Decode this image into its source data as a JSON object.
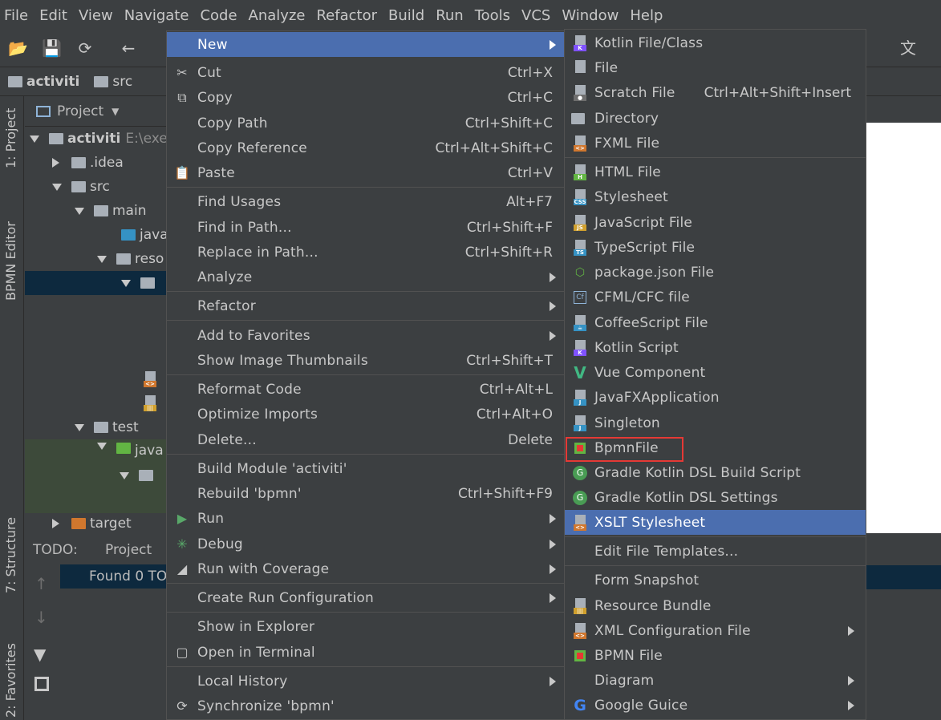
{
  "menubar": [
    "File",
    "Edit",
    "View",
    "Navigate",
    "Code",
    "Analyze",
    "Refactor",
    "Build",
    "Run",
    "Tools",
    "VCS",
    "Window",
    "Help"
  ],
  "breadcrumb": [
    "activiti",
    "src"
  ],
  "side_tabs": {
    "project": "1: Project",
    "bpmn_editor": "BPMN Editor",
    "structure": "7: Structure",
    "favorites": "2: Favorites"
  },
  "project_panel": {
    "title": "Project"
  },
  "tree": {
    "root": "activiti",
    "root_path": "E:\\exe",
    "idea": ".idea",
    "src": "src",
    "main": "main",
    "java": "java",
    "resources": "reso",
    "test": "test",
    "test_java": "java",
    "target": "target"
  },
  "todo": {
    "label": "TODO:",
    "tab": "Project",
    "status": "Found 0 TO"
  },
  "context_menu": {
    "new": "New",
    "cut": "Cut",
    "cut_sc": "Ctrl+X",
    "copy": "Copy",
    "copy_sc": "Ctrl+C",
    "copy_path": "Copy Path",
    "copy_path_sc": "Ctrl+Shift+C",
    "copy_ref": "Copy Reference",
    "copy_ref_sc": "Ctrl+Alt+Shift+C",
    "paste": "Paste",
    "paste_sc": "Ctrl+V",
    "find_usages": "Find Usages",
    "find_usages_sc": "Alt+F7",
    "find_in_path": "Find in Path...",
    "find_in_path_sc": "Ctrl+Shift+F",
    "replace_in_path": "Replace in Path...",
    "replace_in_path_sc": "Ctrl+Shift+R",
    "analyze": "Analyze",
    "refactor": "Refactor",
    "add_favorites": "Add to Favorites",
    "show_thumbs": "Show Image Thumbnails",
    "show_thumbs_sc": "Ctrl+Shift+T",
    "reformat": "Reformat Code",
    "reformat_sc": "Ctrl+Alt+L",
    "optimize": "Optimize Imports",
    "optimize_sc": "Ctrl+Alt+O",
    "delete": "Delete...",
    "delete_sc": "Delete",
    "build_module": "Build Module 'activiti'",
    "rebuild": "Rebuild 'bpmn'",
    "rebuild_sc": "Ctrl+Shift+F9",
    "run": "Run",
    "debug": "Debug",
    "run_coverage": "Run with Coverage",
    "create_run": "Create Run Configuration",
    "show_explorer": "Show in Explorer",
    "open_terminal": "Open in Terminal",
    "local_history": "Local History",
    "synchronize": "Synchronize 'bpmn'"
  },
  "new_submenu": {
    "kotlin_file": "Kotlin File/Class",
    "file": "File",
    "scratch": "Scratch File",
    "scratch_sc": "Ctrl+Alt+Shift+Insert",
    "directory": "Directory",
    "fxml": "FXML File",
    "html": "HTML File",
    "stylesheet": "Stylesheet",
    "js": "JavaScript File",
    "ts": "TypeScript File",
    "package_json": "package.json File",
    "cfml": "CFML/CFC file",
    "coffee": "CoffeeScript File",
    "kotlin_script": "Kotlin Script",
    "vue": "Vue Component",
    "javafx": "JavaFXApplication",
    "singleton": "Singleton",
    "bpmnfile": "BpmnFile",
    "gradle_build": "Gradle Kotlin DSL Build Script",
    "gradle_settings": "Gradle Kotlin DSL Settings",
    "xslt": "XSLT Stylesheet",
    "edit_templates": "Edit File Templates...",
    "form_snapshot": "Form Snapshot",
    "resource_bundle": "Resource Bundle",
    "xml_config": "XML Configuration File",
    "bpmn_file": "BPMN File",
    "diagram": "Diagram",
    "google_guice": "Google Guice"
  },
  "colors": {
    "selection": "#4b6eaf",
    "highlight_box": "#e53935",
    "background": "#3c3f41"
  }
}
